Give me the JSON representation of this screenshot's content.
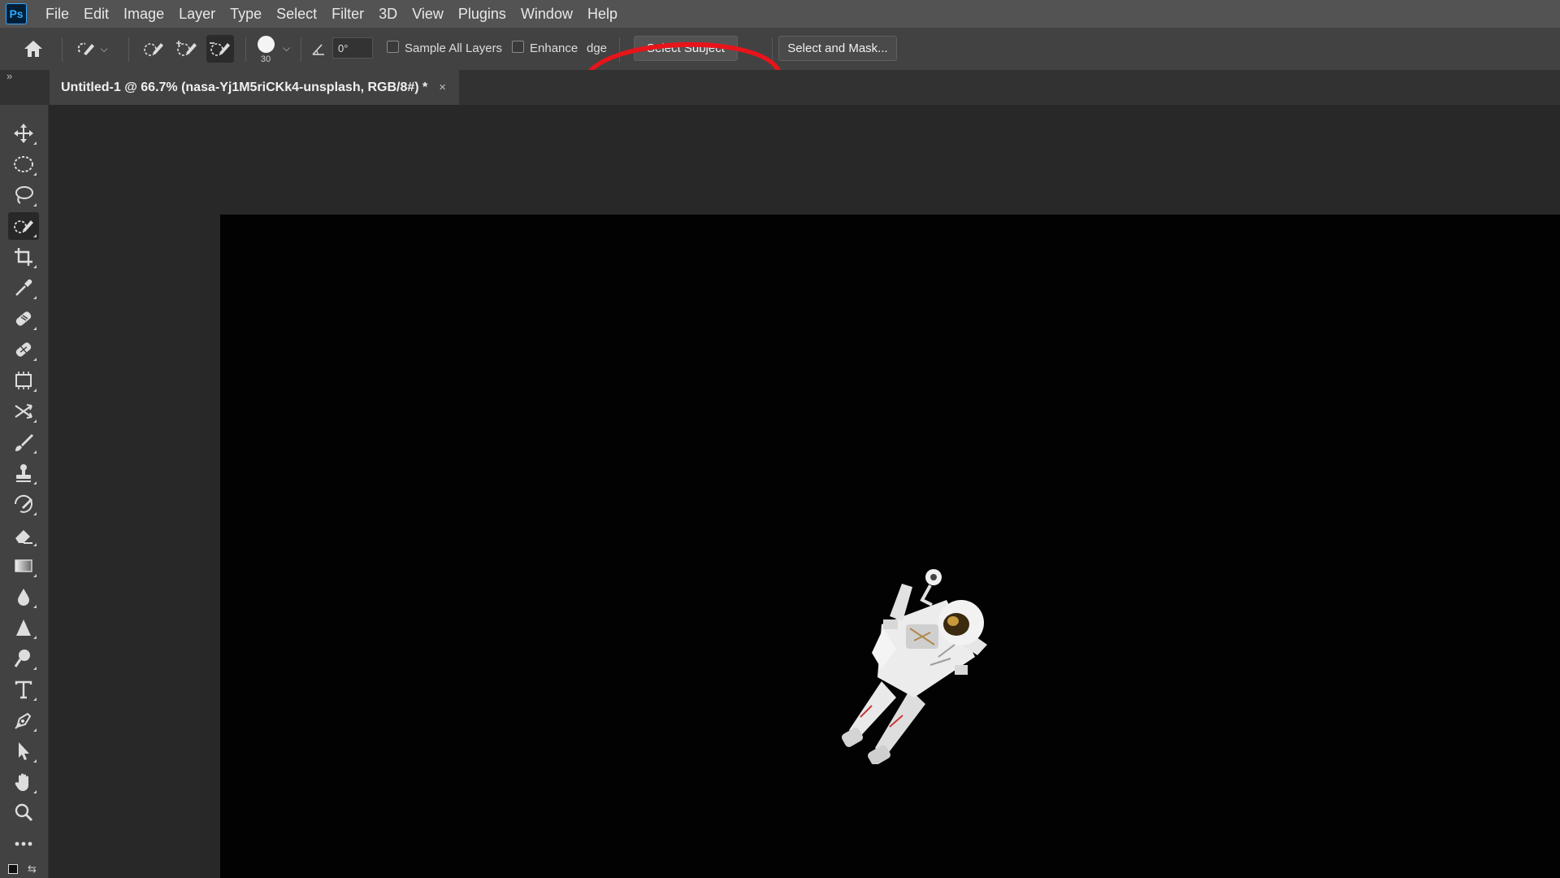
{
  "app": {
    "logo_text": "Ps"
  },
  "menu": [
    "File",
    "Edit",
    "Image",
    "Layer",
    "Type",
    "Select",
    "Filter",
    "3D",
    "View",
    "Plugins",
    "Window",
    "Help"
  ],
  "options": {
    "brush_size": "30",
    "angle_value": "0°",
    "sample_all_layers_label": "Sample All Layers",
    "enhance_edge_label": "Enhance",
    "enhance_edge_suffix": "dge",
    "select_subject_label": "Select Subject",
    "select_and_mask_label": "Select and Mask..."
  },
  "panel_toggle": "»",
  "document": {
    "tab_title": "Untitled-1 @ 66.7% (nasa-Yj1M5riCKk4-unsplash, RGB/8#) *",
    "close_glyph": "×"
  },
  "tools": [
    "move-tool-icon",
    "elliptical-marquee-tool-icon",
    "lasso-tool-icon",
    "quick-selection-tool-icon",
    "crop-tool-icon",
    "eyedropper-tool-icon",
    "spot-healing-brush-icon",
    "patch-tool-icon",
    "frame-tool-icon",
    "content-aware-move-icon",
    "brush-tool-icon",
    "clone-stamp-tool-icon",
    "history-brush-tool-icon",
    "eraser-tool-icon",
    "gradient-tool-icon",
    "blur-tool-icon",
    "sharpen-tool-icon",
    "dodge-tool-icon",
    "type-tool-icon",
    "pen-tool-icon",
    "path-selection-tool-icon",
    "hand-tool-icon",
    "zoom-tool-icon",
    "edit-toolbar-icon"
  ],
  "colors": {
    "annotation": "#e8141b",
    "canvas": "#020203",
    "ps_blue": "#31a8ff"
  }
}
